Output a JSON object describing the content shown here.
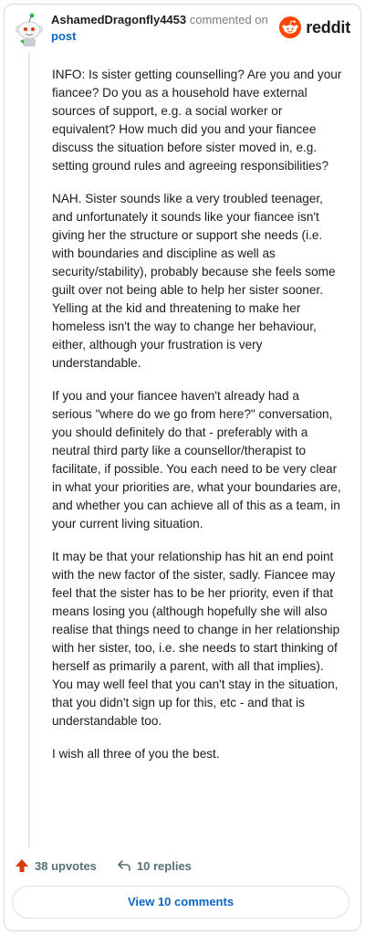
{
  "comment": {
    "username": "AshamedDragonfly4453",
    "action_text": "commented on",
    "post_link": "post",
    "paragraphs": [
      "INFO: Is sister getting counselling? Are you and your fiancee? Do you as a household have external sources of support, e.g. a social worker or equivalent? How much did you and your fiancee discuss the situation before sister moved in, e.g. setting ground rules and agreeing responsibilities?",
      "NAH. Sister sounds like a very troubled teenager, and unfortunately it sounds like your fiancee isn't giving her the structure or support she needs (i.e. with boundaries and discipline as well as security/stability), probably because she feels some guilt over not being able to help her sister sooner. Yelling at the kid and threatening to make her homeless isn't the way to change her behaviour, either, although your frustration is very understandable.",
      "If you and your fiancee haven't already had a serious \"where do we go from here?\" conversation, you should definitely do that - preferably with a neutral third party like a counsellor/therapist to facilitate, if possible. You each need to be very clear in what your priorities are, what your boundaries are, and whether you can achieve all of this as a team, in your current living situation.",
      "It may be that your relationship has hit an end point with the new factor of the sister, sadly. Fiancee may feel that the sister has to be her priority, even if that means losing you (although hopefully she will also realise that things need to change in her relationship with her sister, too, i.e. she needs to start thinking of herself as primarily a parent, with all that implies). You may well feel that you can't stay in the situation, that you didn't sign up for this, etc - and that is understandable too.",
      "I wish all three of you the best."
    ]
  },
  "branding": {
    "logo_text": "reddit",
    "icon": "reddit-logo-icon"
  },
  "actions": {
    "upvotes_label": "38 upvotes",
    "replies_label": "10 replies",
    "view_comments_label": "View 10 comments"
  },
  "colors": {
    "upvote": "#d93a00",
    "reddit_orange": "#ff4500",
    "link": "#0a66c2",
    "muted": "#576f76"
  }
}
